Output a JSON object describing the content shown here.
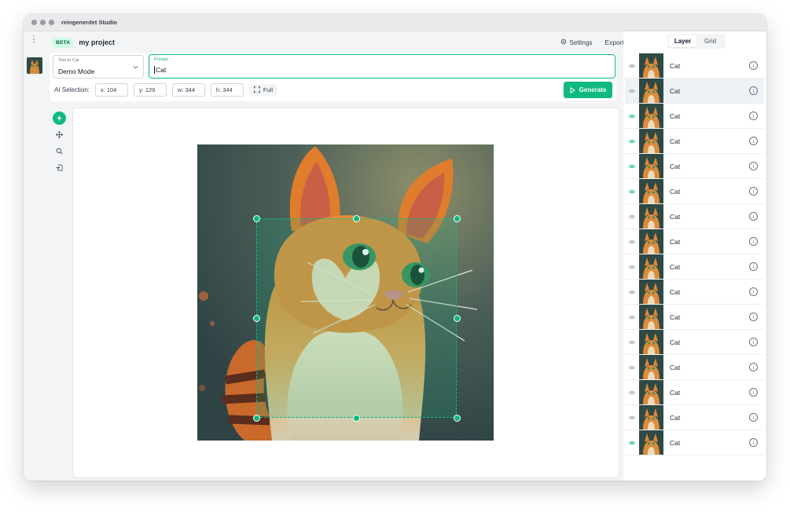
{
  "app": {
    "title": "reingenerdet Studio"
  },
  "header": {
    "beta": "BETA",
    "project_name": "my project",
    "settings_label": "Settings",
    "export_label": "Export"
  },
  "toolbar": {
    "mode_label": "Text to Cat",
    "mode_value": "Demo Mode",
    "prompt_label": "Prompt",
    "prompt_value": "Cat",
    "selection_label": "AI Selection:",
    "x": "x: 104",
    "y": "y: 129",
    "w": "w: 344",
    "h": "h: 344",
    "full_label": "Full",
    "generate_label": "Generate"
  },
  "tools": [
    {
      "name": "ai-select-tool",
      "icon": "sparkle-icon",
      "active": true
    },
    {
      "name": "move-tool",
      "icon": "move-icon",
      "active": false
    },
    {
      "name": "zoom-tool",
      "icon": "magnifier-icon",
      "active": false
    },
    {
      "name": "import-tool",
      "icon": "file-import-icon",
      "active": false
    }
  ],
  "sidebar": {
    "tabs": [
      "Layer",
      "Grid"
    ],
    "active_tab": "Layer",
    "layers": [
      {
        "label": "Cat",
        "visible": false,
        "selected": false
      },
      {
        "label": "Cat",
        "visible": false,
        "selected": true
      },
      {
        "label": "Cat",
        "visible": true,
        "selected": false
      },
      {
        "label": "Cat",
        "visible": true,
        "selected": false
      },
      {
        "label": "Cat",
        "visible": true,
        "selected": false
      },
      {
        "label": "Cat",
        "visible": true,
        "selected": false
      },
      {
        "label": "Cat",
        "visible": false,
        "selected": false
      },
      {
        "label": "Cat",
        "visible": false,
        "selected": false
      },
      {
        "label": "Cat",
        "visible": false,
        "selected": false
      },
      {
        "label": "Cat",
        "visible": false,
        "selected": false
      },
      {
        "label": "Cat",
        "visible": false,
        "selected": false
      },
      {
        "label": "Cat",
        "visible": false,
        "selected": false
      },
      {
        "label": "Cat",
        "visible": false,
        "selected": false
      },
      {
        "label": "Cat",
        "visible": false,
        "selected": false
      },
      {
        "label": "Cat",
        "visible": false,
        "selected": false
      },
      {
        "label": "Cat",
        "visible": true,
        "selected": false
      }
    ]
  },
  "colors": {
    "accent": "#10b981",
    "eye_on": "#10b981",
    "eye_off": "#9ca3af"
  }
}
